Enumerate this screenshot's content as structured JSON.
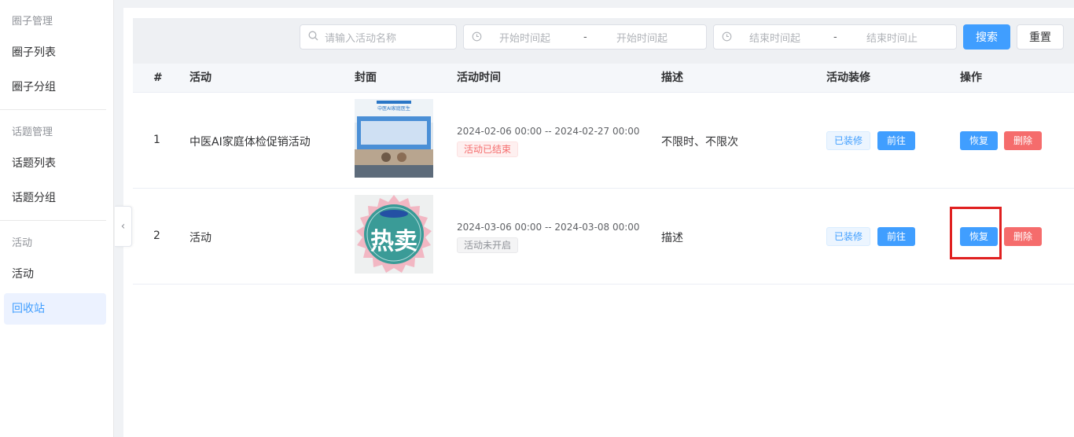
{
  "sidebar": {
    "group1": "圈子管理",
    "item_circle_list": "圈子列表",
    "item_circle_group": "圈子分组",
    "group2": "话题管理",
    "item_topic_list": "话题列表",
    "item_topic_group": "话题分组",
    "group3": "活动",
    "item_activity": "活动",
    "item_recycle": "回收站"
  },
  "search": {
    "name_placeholder": "请输入活动名称",
    "start_from": "开始时间起",
    "start_to": "开始时间起",
    "end_from": "结束时间起",
    "end_to": "结束时间止",
    "separator": "-",
    "search_button": "搜索",
    "reset_button": "重置"
  },
  "table": {
    "headers": {
      "index": "#",
      "activity": "活动",
      "cover": "封面",
      "time": "活动时间",
      "desc": "描述",
      "decor": "活动装修",
      "ops": "操作"
    },
    "rows": [
      {
        "index": "1",
        "name": "中医AI家庭体检促销活动",
        "time": "2024-02-06 00:00 -- 2024-02-27 00:00",
        "status": "活动已结束",
        "desc": "不限时、不限次",
        "decor_tag": "已装修",
        "goto": "前往",
        "restore": "恢复",
        "delete": "删除",
        "cover_caption": "中医AI家庭医生"
      },
      {
        "index": "2",
        "name": "活动",
        "time": "2024-03-06 00:00 -- 2024-03-08 00:00",
        "status": "活动未开启",
        "desc": "描述",
        "decor_tag": "已装修",
        "goto": "前往",
        "restore": "恢复",
        "delete": "删除",
        "cover_caption": "热卖"
      }
    ]
  },
  "colors": {
    "primary": "#409eff",
    "danger": "#f56c6c",
    "highlight": "#e02020"
  }
}
